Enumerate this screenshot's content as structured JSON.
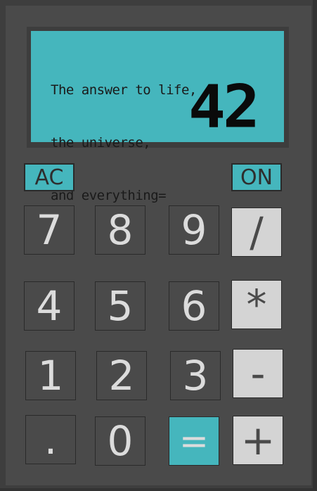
{
  "display": {
    "message_lines": [
      "The answer to life,",
      "the universe,",
      "and everything="
    ],
    "result": "42"
  },
  "controls": {
    "clear_label": "AC",
    "power_label": "ON"
  },
  "keys": {
    "seven": "7",
    "eight": "8",
    "nine": "9",
    "divide": "/",
    "four": "4",
    "five": "5",
    "six": "6",
    "multiply": "*",
    "one": "1",
    "two": "2",
    "three": "3",
    "subtract": "-",
    "decimal": ".",
    "zero": "0",
    "equals": "=",
    "add": "+"
  },
  "colors": {
    "screen": "#45b6bd",
    "body": "#4a4a4a",
    "operator_key": "#d4d4d4",
    "digit_text": "#dcdcdc"
  }
}
